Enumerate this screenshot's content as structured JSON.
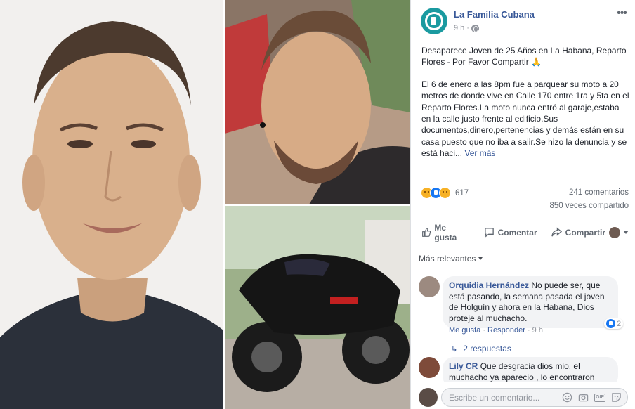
{
  "post": {
    "page_name": "La Familia Cubana",
    "time": "9 h",
    "meta_separator": "·",
    "title_text": "Desaparece Joven de 25 Años en La Habana, Reparto Flores - Por Favor Compartir 🙏",
    "body_text": "El 6 de enero a las 8pm fue a parquear su moto a 20 metros de donde vive en Calle 170 entre 1ra y 5ta en el Reparto Flores.La moto nunca entró al garaje,estaba en la calle justo frente al edificio.Sus documentos,dinero,pertenencias y demás están en su casa puesto que no iba a salir.Se hizo la denuncia y se está haci...",
    "see_more": "Ver más",
    "more_icon": "more-horizontal-icon"
  },
  "stats": {
    "reaction_icons": [
      "sad-reaction-icon",
      "like-reaction-icon",
      "wow-reaction-icon"
    ],
    "reaction_count": "617",
    "comments": "241 comentarios",
    "shares": "850 veces compartido"
  },
  "actions": {
    "like": "Me gusta",
    "comment": "Comentar",
    "share": "Compartir"
  },
  "comments_section": {
    "sort_label": "Más relevantes",
    "comments": [
      {
        "author": "Orquidia Hernández",
        "text": "No puede ser, que está pasando, la semana pasada el joven de Holguín y ahora en la Habana, Dios proteje al muchacho.",
        "like_label": "Me gusta",
        "reply_label": "Responder",
        "time": "9 h",
        "reaction_count": "2",
        "separator": "·"
      },
      {
        "author": "Lily CR",
        "text": "Que desgracia dios mio, el muchacho ya aparecio , lo encontraron"
      }
    ],
    "replies_label": "2 respuestas",
    "replies_arrow": "↳"
  },
  "composer": {
    "placeholder": "Escribe un comentario...",
    "icons": [
      "emoji-icon",
      "camera-icon",
      "gif-icon",
      "sticker-icon"
    ],
    "gif_label": "GIF"
  },
  "colors": {
    "link_blue": "#385898",
    "meta_gray": "#90949c",
    "like_blue": "#1877f2",
    "page_avatar_teal": "#1a9aa0"
  }
}
